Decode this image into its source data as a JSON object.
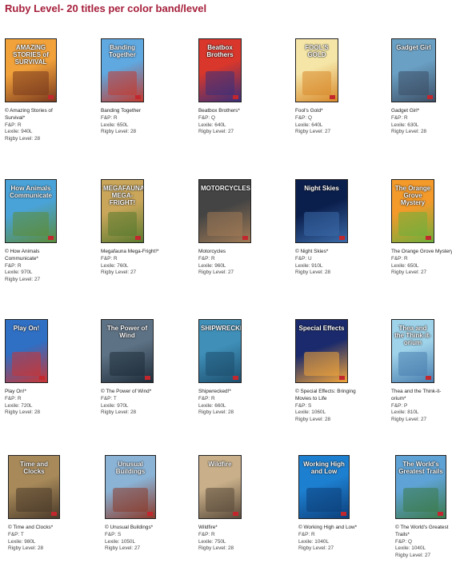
{
  "header": {
    "title": "Ruby Level- 20 titles per color band/level"
  },
  "labels": {
    "fp": "F&P:",
    "lexile": "Lexile:",
    "rigby": "Rigby Level:"
  },
  "books": [
    {
      "title": "© Amazing Stories of Survival*",
      "fp": "R",
      "lexile": "940L",
      "rigby": "28",
      "cover_text": "AMAZING STORIES of SURVIVAL",
      "colors": [
        "#f2a23b",
        "#7a3a1e"
      ]
    },
    {
      "title": "Banding Together",
      "fp": "R",
      "lexile": "650L",
      "rigby": "28",
      "cover_text": "Banding Together",
      "colors": [
        "#5fa8e0",
        "#c23a2f"
      ]
    },
    {
      "title": "Beatbox Brothers*",
      "fp": "Q",
      "lexile": "640L",
      "rigby": "27",
      "cover_text": "Beatbox Brothers",
      "colors": [
        "#d9372b",
        "#3a2f7a"
      ]
    },
    {
      "title": "Fool's Gold*",
      "fp": "Q",
      "lexile": "640L",
      "rigby": "27",
      "cover_text": "FOOL'S GOLD",
      "colors": [
        "#f5e6a8",
        "#d98a2b"
      ]
    },
    {
      "title": "Gadget Girl*",
      "fp": "R",
      "lexile": "630L",
      "rigby": "28",
      "cover_text": "Gadget Girl",
      "colors": [
        "#6aa0c4",
        "#3d4f66"
      ]
    },
    {
      "title": "© How Animals Communicate*",
      "fp": "R",
      "lexile": "970L",
      "rigby": "27",
      "cover_text": "How Animals Communicate",
      "colors": [
        "#4aa3d8",
        "#5b8c3a"
      ]
    },
    {
      "title": "Megafauna Mega-Fright!*",
      "fp": "R",
      "lexile": "760L",
      "rigby": "27",
      "cover_text": "MEGAFAUNA MEGA-FRIGHT!",
      "colors": [
        "#c9a65a",
        "#5a7a2f"
      ]
    },
    {
      "title": "Motorcycles",
      "fp": "R",
      "lexile": "960L",
      "rigby": "27",
      "cover_text": "MOTORCYCLES",
      "colors": [
        "#444444",
        "#a07a55"
      ]
    },
    {
      "title": "© Night Skies*",
      "fp": "U",
      "lexile": "910L",
      "rigby": "28",
      "cover_text": "Night Skies",
      "colors": [
        "#0b1f4d",
        "#3b6aa8"
      ]
    },
    {
      "title": "The Orange Grove Mystery*",
      "fp": "R",
      "lexile": "650L",
      "rigby": "27",
      "cover_text": "The Orange Grove Mystery",
      "colors": [
        "#f39a2b",
        "#6fae3a"
      ]
    },
    {
      "title": "Play On!*",
      "fp": "R",
      "lexile": "720L",
      "rigby": "28",
      "cover_text": "Play On!",
      "colors": [
        "#2f6fc4",
        "#c93535"
      ]
    },
    {
      "title": "© The Power of Wind*",
      "fp": "T",
      "lexile": "970L",
      "rigby": "28",
      "cover_text": "The Power of Wind",
      "colors": [
        "#5d7285",
        "#1f2d3a"
      ]
    },
    {
      "title": "Shipwrecked!*",
      "fp": "R",
      "lexile": "660L",
      "rigby": "28",
      "cover_text": "SHIPWRECKED!",
      "colors": [
        "#3f8fb8",
        "#1d4f6e"
      ]
    },
    {
      "title": "© Special Effects: Bringing Movies to Life",
      "fp": "S",
      "lexile": "1060L",
      "rigby": "28",
      "cover_text": "Special Effects",
      "colors": [
        "#1a2a6c",
        "#f3a53a"
      ]
    },
    {
      "title": "Thea and the Think-it-orium*",
      "fp": "P",
      "lexile": "810L",
      "rigby": "27",
      "cover_text": "Thea and the Think-it-orium",
      "colors": [
        "#9fd3ea",
        "#4a7fb0"
      ]
    },
    {
      "title": "© Time and Clocks*",
      "fp": "T",
      "lexile": "980L",
      "rigby": "28",
      "cover_text": "Time and Clocks",
      "colors": [
        "#a88a5a",
        "#4a3a2a"
      ]
    },
    {
      "title": "© Unusual Buildings*",
      "fp": "S",
      "lexile": "1050L",
      "rigby": "27",
      "cover_text": "Unusual Buildings",
      "colors": [
        "#8ab3d6",
        "#8a3a2a"
      ]
    },
    {
      "title": "Wildfire*",
      "fp": "R",
      "lexile": "750L",
      "rigby": "28",
      "cover_text": "Wildfire",
      "colors": [
        "#c9b08a",
        "#5a4a3a"
      ]
    },
    {
      "title": "© Working High and Low*",
      "fp": "R",
      "lexile": "1040L",
      "rigby": "27",
      "cover_text": "Working High and Low",
      "colors": [
        "#1d7fd0",
        "#0d3f7a"
      ]
    },
    {
      "title": "© The World's Greatest Trails*",
      "fp": "Q",
      "lexile": "1040L",
      "rigby": "27",
      "cover_text": "The World's Greatest Trails",
      "colors": [
        "#5fa3d6",
        "#3b7a4a"
      ]
    }
  ]
}
